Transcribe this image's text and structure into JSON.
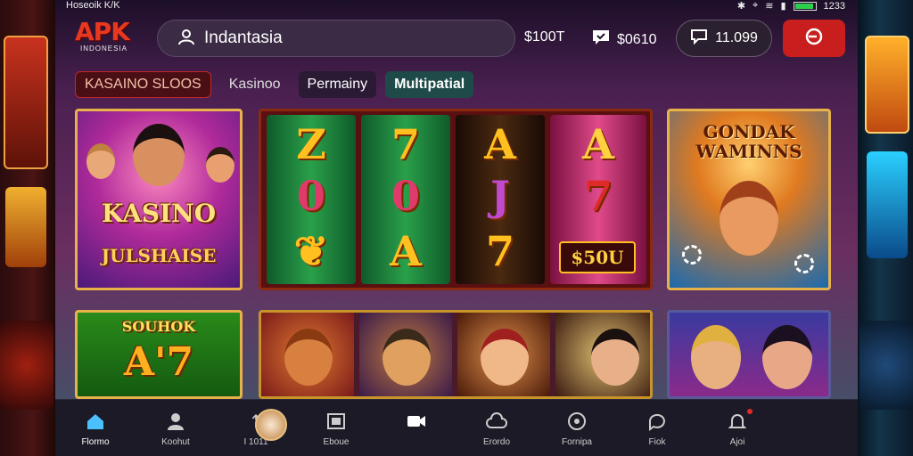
{
  "status": {
    "left": "Hoseoik K/K",
    "right": "1233"
  },
  "header": {
    "logo_big": "APK",
    "logo_small": "INDONESIA",
    "search_value": "Indantasia",
    "stat_one": "$100T",
    "stat_two": "$0610",
    "wallet": "11.099"
  },
  "tabs": [
    {
      "label": "KASAINO SLOOS"
    },
    {
      "label": "Kasinoo"
    },
    {
      "label": "Permainy"
    },
    {
      "label": "Multipatial"
    }
  ],
  "tiles": {
    "kasino": {
      "title": "KASINO",
      "subtitle": "JULSHAISE"
    },
    "slot": {
      "reel1": [
        "Z",
        "0",
        "❦"
      ],
      "reel2": [
        "7",
        "0",
        "A"
      ],
      "reel3": [
        "A",
        "J",
        "7"
      ],
      "reel4": [
        "A",
        "7"
      ],
      "button": "$50U"
    },
    "gondak": {
      "title": "GONDAK\nWAMINNS"
    },
    "souhok": {
      "title": "SOUHOK",
      "big": "A'7"
    }
  },
  "nav": [
    {
      "label": "Flormo",
      "icon": "home-icon",
      "active": true
    },
    {
      "label": "Koohut",
      "icon": "users-icon"
    },
    {
      "label": "I 1011",
      "icon": "arrow-icon"
    },
    {
      "label": "Eboue",
      "icon": "frame-icon"
    },
    {
      "label": "",
      "icon": "video-icon"
    },
    {
      "label": "Erordo",
      "icon": "cloud-icon"
    },
    {
      "label": "Fornipa",
      "icon": "target-icon"
    },
    {
      "label": "Fiok",
      "icon": "chat-icon"
    },
    {
      "label": "Ajoi",
      "icon": "bell-icon"
    }
  ],
  "colors": {
    "accent": "#e8b24a",
    "brand": "#e83820",
    "exit": "#c81e1e",
    "nav_active": "#4ac0ff"
  },
  "battery_level": 0.95
}
